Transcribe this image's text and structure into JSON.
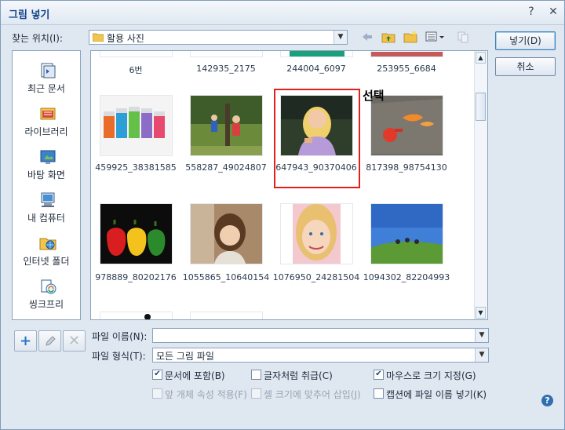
{
  "window": {
    "title": "그림 넣기",
    "help_glyph": "?",
    "close_glyph": "✕"
  },
  "lookin": {
    "label": "찾는 위치(I):",
    "value": "활용 사진"
  },
  "buttons": {
    "ok": "넣기(D)",
    "cancel": "취소"
  },
  "places": [
    {
      "label": "최근 문서",
      "icon": "recent-docs-icon"
    },
    {
      "label": "라이브러리",
      "icon": "library-icon"
    },
    {
      "label": "바탕 화면",
      "icon": "desktop-icon"
    },
    {
      "label": "내 컴퓨터",
      "icon": "computer-icon"
    },
    {
      "label": "인터넷 폴더",
      "icon": "internet-folder-icon"
    },
    {
      "label": "씽크프리",
      "icon": "thinkfree-icon"
    }
  ],
  "files": {
    "row0": [
      "6번",
      "142935_2175",
      "244004_6097",
      "253955_6684"
    ],
    "row1": [
      "459925_38381585",
      "558287_49024807",
      "647943_90370406",
      "817398_98754130"
    ],
    "row2": [
      "978889_80202176",
      "1055865_10640154",
      "1076950_24281504",
      "1094302_82204993"
    ],
    "selected_note": "선택",
    "selected_index": 6
  },
  "form": {
    "filename_label": "파일 이름(N):",
    "filename_value": "",
    "filetype_label": "파일 형식(T):",
    "filetype_value": "모든 그림 파일"
  },
  "options": [
    {
      "label": "문서에 포함(B)",
      "checked": true,
      "enabled": true
    },
    {
      "label": "글자처럼 취급(C)",
      "checked": false,
      "enabled": true
    },
    {
      "label": "마우스로 크기 지정(G)",
      "checked": true,
      "enabled": true
    },
    {
      "label": "앞 개체 속성 적용(F)",
      "checked": false,
      "enabled": false
    },
    {
      "label": "셀 크기에 맞추어 삽입(J)",
      "checked": false,
      "enabled": false
    },
    {
      "label": "캡션에 파일 이름 넣기(K)",
      "checked": false,
      "enabled": true
    }
  ],
  "colors": {
    "selection_border": "#e0201c",
    "title_text": "#15428b"
  }
}
